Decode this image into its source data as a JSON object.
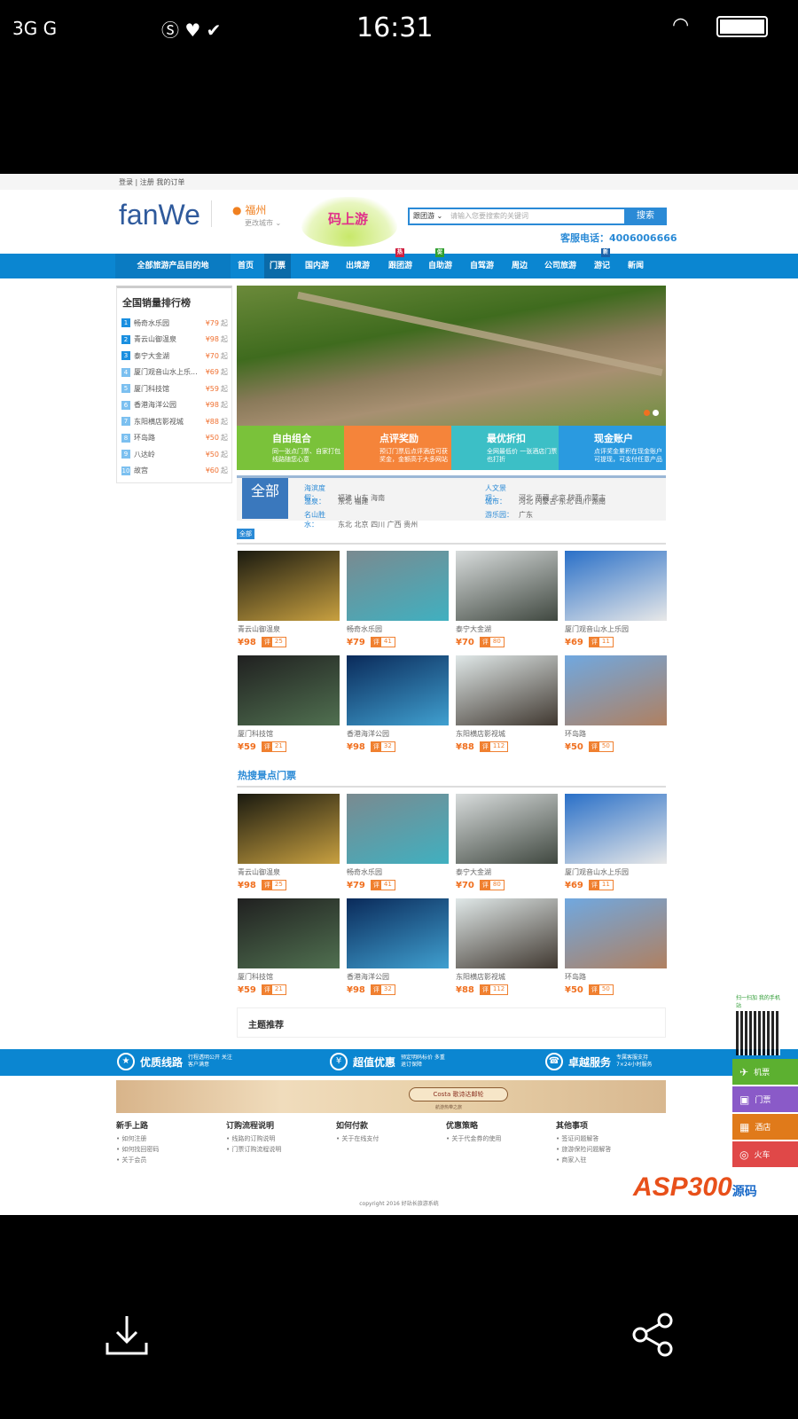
{
  "status": {
    "left": "3G G",
    "time": "16:31"
  },
  "top_links": "登录 | 注册   我的订单",
  "header": {
    "logo": "fanWe",
    "city": "福州",
    "change_city": "更改城市 ⌄",
    "promo": "码上游",
    "search_type": "跟团游 ⌄",
    "search_placeholder": "请输入您要搜索的关键词",
    "search_button": "搜索",
    "phone": "客服电话：4006006666"
  },
  "nav": {
    "all": "全部旅游产品目的地",
    "items": [
      {
        "label": "首页"
      },
      {
        "label": "门票",
        "active": true
      },
      {
        "label": "国内游"
      },
      {
        "label": "出境游"
      },
      {
        "label": "跟团游",
        "badge": "热",
        "badge_color": "#d02040"
      },
      {
        "label": "自助游",
        "badge": "促",
        "badge_color": "#30a030"
      },
      {
        "label": "自驾游"
      },
      {
        "label": "周边"
      },
      {
        "label": "公司旅游"
      },
      {
        "label": "游记",
        "badge": "新",
        "badge_color": "#1a60a8"
      },
      {
        "label": "新闻"
      }
    ]
  },
  "ranking": {
    "title": "全国销量排行榜",
    "items": [
      {
        "n": "1",
        "name": "畅奇水乐园",
        "price": "¥79",
        "suffix": "起"
      },
      {
        "n": "2",
        "name": "青云山御温泉",
        "price": "¥98",
        "suffix": "起"
      },
      {
        "n": "3",
        "name": "泰宁大金湖",
        "price": "¥70",
        "suffix": "起"
      },
      {
        "n": "4",
        "name": "厦门观音山水上乐...",
        "price": "¥69",
        "suffix": "起"
      },
      {
        "n": "5",
        "name": "厦门科技馆",
        "price": "¥59",
        "suffix": "起"
      },
      {
        "n": "6",
        "name": "香港海洋公园",
        "price": "¥98",
        "suffix": "起"
      },
      {
        "n": "7",
        "name": "东阳横店影视城",
        "price": "¥88",
        "suffix": "起"
      },
      {
        "n": "8",
        "name": "环岛路",
        "price": "¥50",
        "suffix": "起"
      },
      {
        "n": "9",
        "name": "八达岭",
        "price": "¥50",
        "suffix": "起"
      },
      {
        "n": "10",
        "name": "故宫",
        "price": "¥60",
        "suffix": "起"
      }
    ]
  },
  "tiles": [
    {
      "title": "自由组合",
      "desc": "同一张点门票、自家打包线路随您心意",
      "color": "#7ac23a"
    },
    {
      "title": "点评奖励",
      "desc": "预订门票后点评酒店可获奖金，金额高于大多网站",
      "color": "#f5843a"
    },
    {
      "title": "最优折扣",
      "desc": "全网最低价 一张酒店门票也打折",
      "color": "#3cbfc6"
    },
    {
      "title": "现金账户",
      "desc": "点评奖金累积在现金账户可提现，可支付任意产品",
      "color": "#2a9ae0"
    }
  ],
  "filter": {
    "all": "全部",
    "groups": [
      {
        "key": "海滨度假：",
        "values": "福建  山东  海南"
      },
      {
        "key": "温泉：",
        "values": "东北  福建"
      },
      {
        "key": "名山胜水：",
        "values": "东北  北京  四川  广西  贵州"
      },
      {
        "key": "人文景观：",
        "values": "河北  西藏  北京  陕西  内蒙古"
      },
      {
        "key": "城市：",
        "values": "河北  内蒙古  东北  四川  湖南"
      },
      {
        "key": "游乐园：",
        "values": "广东"
      }
    ]
  },
  "section_tag": "全部",
  "hot_title": "热搜景点门票",
  "cards": [
    {
      "name": "青云山御温泉",
      "price": "¥98",
      "count": "25",
      "c1": "#1a1a10",
      "c2": "#c8a040"
    },
    {
      "name": "畅奇水乐园",
      "price": "¥79",
      "count": "41",
      "c1": "#7a8a90",
      "c2": "#40b0c0"
    },
    {
      "name": "泰宁大金湖",
      "price": "¥70",
      "count": "80",
      "c1": "#d8dcdc",
      "c2": "#404840"
    },
    {
      "name": "厦门观音山水上乐园",
      "price": "¥69",
      "count": "11",
      "c1": "#2a70c8",
      "c2": "#e8e8e8"
    },
    {
      "name": "厦门科技馆",
      "price": "¥59",
      "count": "21",
      "c1": "#202020",
      "c2": "#507050"
    },
    {
      "name": "香港海洋公园",
      "price": "¥98",
      "count": "32",
      "c1": "#0a2a5a",
      "c2": "#40a0d0"
    },
    {
      "name": "东阳横店影视城",
      "price": "¥88",
      "count": "112",
      "c1": "#e0e8e8",
      "c2": "#403830"
    },
    {
      "name": "环岛路",
      "price": "¥50",
      "count": "50",
      "c1": "#70a8e0",
      "c2": "#b08060"
    }
  ],
  "theme": "主题推荐",
  "band": [
    {
      "title": "优质线路",
      "sub": "行程透明公开 关注客户满意",
      "icon": "★"
    },
    {
      "title": "超值优惠",
      "sub": "预定明码标价 多重退订保障",
      "icon": "¥"
    },
    {
      "title": "卓越服务",
      "sub": "专属客服支持 7×24小时服务",
      "icon": "☎"
    }
  ],
  "ad": {
    "brand": "Costa 歌诗达邮轮",
    "sub": "航游热带之旅"
  },
  "footer": [
    {
      "title": "新手上路",
      "links": [
        "如何注册",
        "如何找回密码",
        "关于会员"
      ]
    },
    {
      "title": "订购流程说明",
      "links": [
        "线路的订购说明",
        "门票订购流程说明"
      ]
    },
    {
      "title": "如何付款",
      "links": [
        "关于在线支付"
      ]
    },
    {
      "title": "优惠策略",
      "links": [
        "关于代金券的使用"
      ]
    },
    {
      "title": "其他事项",
      "links": [
        "签证问题解答",
        "旅游保险问题解答",
        "商家入驻"
      ]
    }
  ],
  "copyright": "copyright 2016 好站长旅游系统",
  "side": {
    "qr_caption": "扫一扫加 我的手机站",
    "buttons": [
      {
        "label": "机票",
        "color": "#5cb030",
        "icon": "✈"
      },
      {
        "label": "门票",
        "color": "#8a5ac8",
        "icon": "▣"
      },
      {
        "label": "酒店",
        "color": "#e07a1a",
        "icon": "▦"
      },
      {
        "label": "火车",
        "color": "#e04848",
        "icon": "◎"
      }
    ]
  },
  "watermark": {
    "text": "ASP300",
    "sub": "源码"
  }
}
